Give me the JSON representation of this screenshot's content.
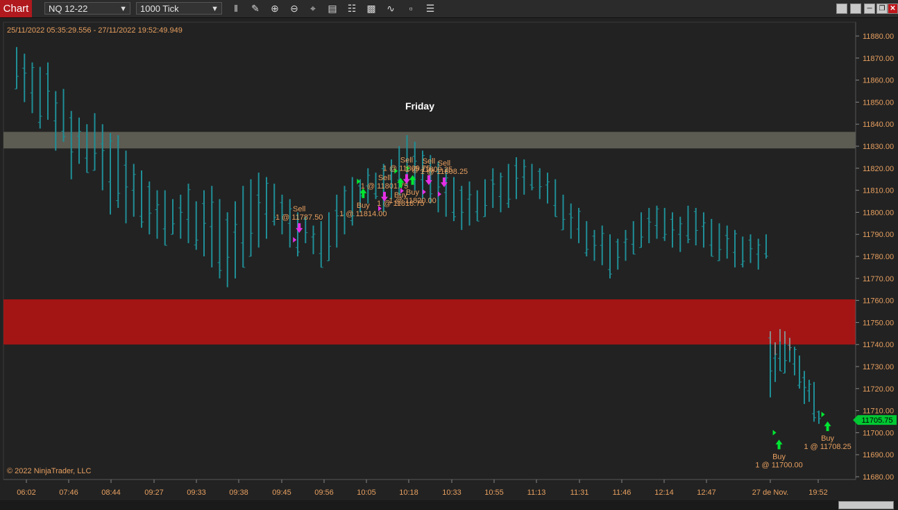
{
  "toolbar": {
    "chart_tab": "Chart",
    "instrument": "NQ 12-22",
    "interval": "1000 Tick",
    "tools": [
      "bar-type-icon",
      "draw-pencil-icon",
      "zoom-in-icon",
      "zoom-out-icon",
      "crosshair-icon",
      "data-box-icon",
      "properties-icon",
      "strategies-icon",
      "indicators-icon",
      "templates-icon",
      "list-icon"
    ]
  },
  "window_buttons": [
    "minimize",
    "tile",
    "maximize",
    "restore",
    "close"
  ],
  "chart_header": {
    "date_range": "25/11/2022 05:35:29.556 - 27/11/2022 19:52:49.949",
    "day_label": "Friday",
    "copyright": "© 2022 NinjaTrader, LLC"
  },
  "colors": {
    "bars": "#1f8f97",
    "resistance_zone": "#5c5c52",
    "support_zone": "#a31515",
    "buy": "#00e632",
    "sell": "#e52fe5",
    "label_text": "#e8a060",
    "price_marker": "#00c832"
  },
  "chart_data": {
    "type": "bar",
    "instrument": "NQ 12-22",
    "y_axis": {
      "range": [
        11675,
        11885
      ],
      "ticks": [
        "11880.00",
        "11870.00",
        "11860.00",
        "11850.00",
        "11840.00",
        "11830.00",
        "11820.00",
        "11810.00",
        "11800.00",
        "11790.00",
        "11780.00",
        "11770.00",
        "11760.00",
        "11750.00",
        "11740.00",
        "11730.00",
        "11720.00",
        "11710.00",
        "11700.00",
        "11690.00",
        "11680.00"
      ]
    },
    "x_axis": {
      "ticks": [
        "06:02",
        "07:46",
        "08:44",
        "09:27",
        "09:33",
        "09:38",
        "09:45",
        "09:56",
        "10:05",
        "10:18",
        "10:33",
        "10:55",
        "11:13",
        "11:31",
        "11:46",
        "12:14",
        "12:47",
        "27 de Nov.",
        "19:52"
      ]
    },
    "last_price": "11705.75",
    "zones": [
      {
        "name": "resistance-zone",
        "from": 11829,
        "to": 11836.5
      },
      {
        "name": "support-zone",
        "from": 11740,
        "to": 11760.5
      }
    ],
    "bars": [
      [
        11856,
        11875
      ],
      [
        11850,
        11872
      ],
      [
        11845,
        11868
      ],
      [
        11838,
        11866
      ],
      [
        11842,
        11868
      ],
      [
        11828,
        11855
      ],
      [
        11832,
        11856
      ],
      [
        11815,
        11846
      ],
      [
        11822,
        11843
      ],
      [
        11818,
        11840
      ],
      [
        11819,
        11845
      ],
      [
        11810,
        11840
      ],
      [
        11799,
        11836
      ],
      [
        11802,
        11835
      ],
      [
        11795,
        11828
      ],
      [
        11798,
        11822
      ],
      [
        11793,
        11819
      ],
      [
        11790,
        11814
      ],
      [
        11788,
        11810
      ],
      [
        11785,
        11810
      ],
      [
        11790,
        11806
      ],
      [
        11788,
        11808
      ],
      [
        11786,
        11813
      ],
      [
        11783,
        11805
      ],
      [
        11780,
        11810
      ],
      [
        11775,
        11812
      ],
      [
        11770,
        11806
      ],
      [
        11766,
        11800
      ],
      [
        11770,
        11805
      ],
      [
        11775,
        11812
      ],
      [
        11780,
        11815
      ],
      [
        11784,
        11818
      ],
      [
        11788,
        11816
      ],
      [
        11794,
        11813
      ],
      [
        11790,
        11808
      ],
      [
        11784,
        11806
      ],
      [
        11780,
        11800
      ],
      [
        11786,
        11798
      ],
      [
        11781,
        11794
      ],
      [
        11775,
        11796
      ],
      [
        11778,
        11800
      ],
      [
        11784,
        11808
      ],
      [
        11790,
        11812
      ],
      [
        11794,
        11816
      ],
      [
        11800,
        11815
      ],
      [
        11804,
        11820
      ],
      [
        11806,
        11818
      ],
      [
        11800,
        11822
      ],
      [
        11806,
        11824
      ],
      [
        11808,
        11830
      ],
      [
        11812,
        11835
      ],
      [
        11810,
        11832
      ],
      [
        11806,
        11828
      ],
      [
        11804,
        11826
      ],
      [
        11800,
        11823
      ],
      [
        11798,
        11820
      ],
      [
        11796,
        11816
      ],
      [
        11792,
        11812
      ],
      [
        11794,
        11814
      ],
      [
        11796,
        11810
      ],
      [
        11798,
        11815
      ],
      [
        11802,
        11820
      ],
      [
        11800,
        11818
      ],
      [
        11802,
        11822
      ],
      [
        11806,
        11825
      ],
      [
        11808,
        11824
      ],
      [
        11810,
        11822
      ],
      [
        11806,
        11820
      ],
      [
        11804,
        11818
      ],
      [
        11798,
        11815
      ],
      [
        11792,
        11808
      ],
      [
        11788,
        11804
      ],
      [
        11786,
        11802
      ],
      [
        11780,
        11796
      ],
      [
        11778,
        11792
      ],
      [
        11776,
        11794
      ],
      [
        11770,
        11790
      ],
      [
        11774,
        11788
      ],
      [
        11778,
        11792
      ],
      [
        11781,
        11796
      ],
      [
        11784,
        11800
      ],
      [
        11786,
        11802
      ],
      [
        11788,
        11803
      ],
      [
        11787,
        11802
      ],
      [
        11784,
        11800
      ],
      [
        11782,
        11798
      ],
      [
        11786,
        11803
      ],
      [
        11785,
        11802
      ],
      [
        11784,
        11800
      ],
      [
        11780,
        11797
      ],
      [
        11778,
        11795
      ],
      [
        11779,
        11794
      ],
      [
        11775,
        11792
      ],
      [
        11775,
        11789
      ],
      [
        11777,
        11790
      ],
      [
        11774,
        11788
      ],
      [
        11779,
        11790
      ],
      [
        11716,
        11746
      ],
      [
        11723,
        11741
      ],
      [
        11728,
        11747
      ],
      [
        11727,
        11746
      ],
      [
        11732,
        11743
      ],
      [
        11726,
        11739
      ],
      [
        11720,
        11735
      ],
      [
        11713,
        11728
      ],
      [
        11714,
        11724
      ],
      [
        11705,
        11723
      ],
      [
        11704,
        11710
      ]
    ],
    "executions": [
      {
        "side": "Sell",
        "label": "Sell",
        "detail": "1 @ 11787.50",
        "x": 0.343,
        "price": 11787.5
      },
      {
        "side": "Buy",
        "label": "Buy",
        "detail": "1 @ 11814.00",
        "x": 0.418,
        "price": 11814
      },
      {
        "side": "Sell",
        "label": "Sell",
        "detail": "1 @ 11801.75",
        "x": 0.443,
        "price": 11801.75
      },
      {
        "side": "Buy",
        "label": "Buy",
        "detail": "1 @ 11818.75",
        "x": 0.462,
        "price": 11818.75
      },
      {
        "side": "Sell",
        "label": "Sell",
        "detail": "1 @ 11809.75",
        "x": 0.469,
        "price": 11809.75
      },
      {
        "side": "Buy",
        "label": "Buy",
        "detail": "1 @ 11820.00",
        "x": 0.476,
        "price": 11820
      },
      {
        "side": "Sell",
        "label": "Sell",
        "detail": "1 @ 11809.25",
        "x": 0.495,
        "price": 11809.25
      },
      {
        "side": "Sell",
        "label": "Sell",
        "detail": "1 @ 11808.25",
        "x": 0.513,
        "price": 11808.25
      },
      {
        "side": "Buy",
        "label": "Buy",
        "detail": "1 @ 11700.00",
        "x": 0.906,
        "price": 11700
      },
      {
        "side": "Buy",
        "label": "Buy",
        "detail": "1 @ 11708.25",
        "x": 0.963,
        "price": 11708.25
      }
    ]
  }
}
